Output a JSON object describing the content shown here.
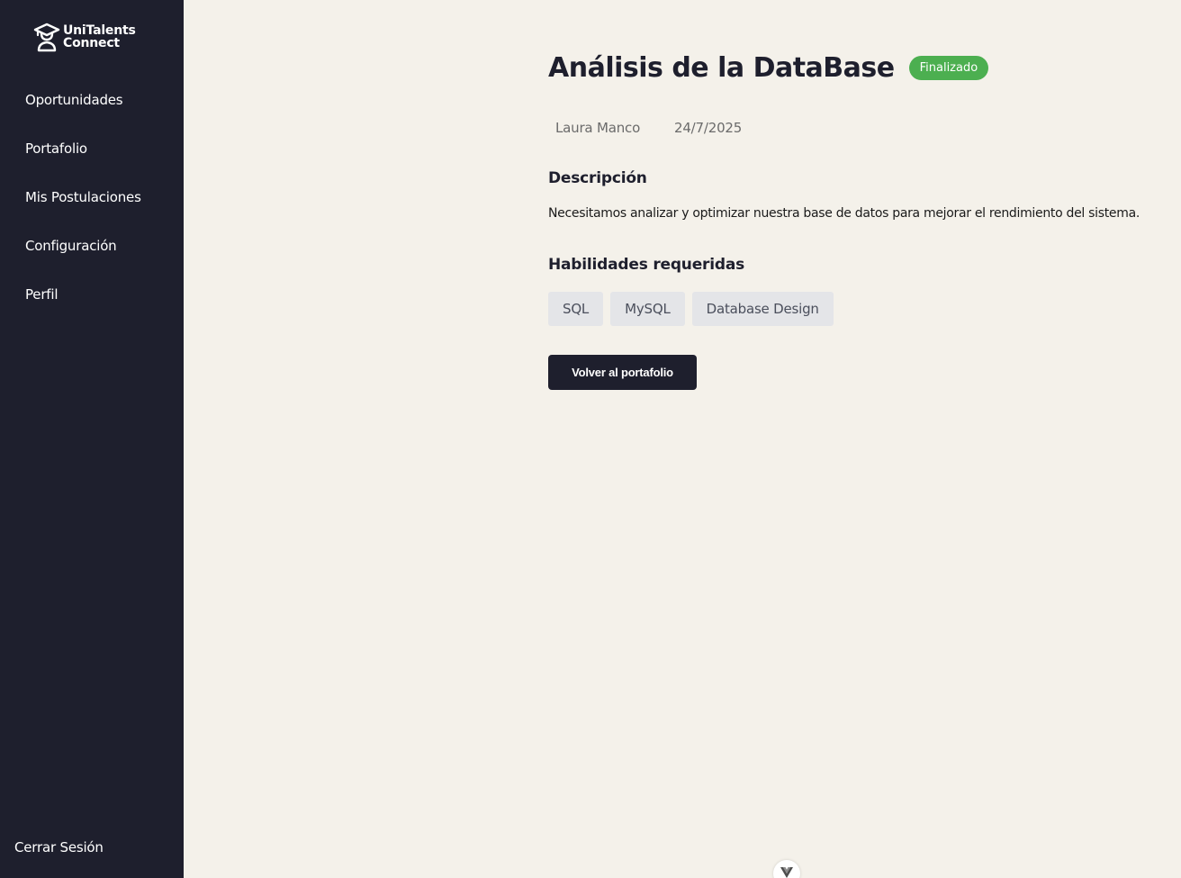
{
  "brand": {
    "line1": "UniTalents",
    "line2": "Connect"
  },
  "sidebar": {
    "items": [
      {
        "label": "Oportunidades"
      },
      {
        "label": "Portafolio"
      },
      {
        "label": "Mis Postulaciones"
      },
      {
        "label": "Configuración"
      },
      {
        "label": "Perfil"
      }
    ],
    "logout_label": "Cerrar Sesión"
  },
  "project": {
    "title": "Análisis de la DataBase",
    "status": "Finalizado",
    "author": "Laura Manco",
    "date": "24/7/2025",
    "description_heading": "Descripción",
    "description": "Necesitamos analizar y optimizar nuestra base de datos para mejorar el rendimiento del sistema.",
    "skills_heading": "Habilidades requeridas",
    "skills": [
      "SQL",
      "MySQL",
      "Database Design"
    ],
    "back_label": "Volver al portafolio"
  },
  "colors": {
    "sidebar_bg": "#1e1f2d",
    "page_bg": "#f4f1ea",
    "status_green": "#4caf50",
    "skill_tag_bg": "#e4e5e8"
  },
  "icons": {
    "logo": "graduation-cap-user-icon",
    "devtools": "vue-devtools-icon"
  }
}
